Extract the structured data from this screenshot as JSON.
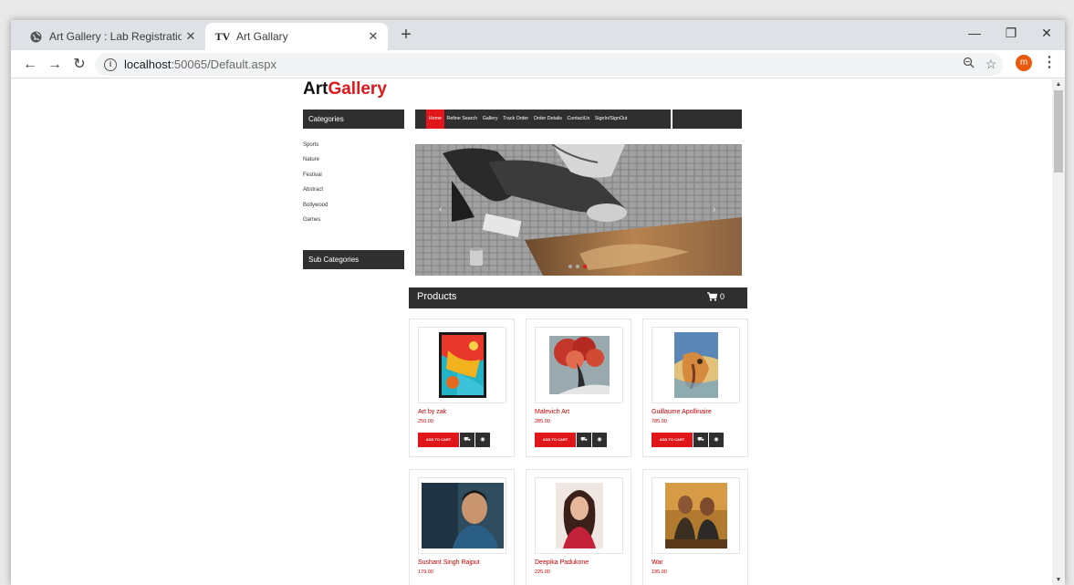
{
  "browser": {
    "tabs": [
      {
        "title": "Art Gallery : Lab Registration",
        "favicon": "globe-icon",
        "active": false
      },
      {
        "title": "Art Gallary",
        "favicon": "TV",
        "active": true
      }
    ],
    "url_host": "localhost",
    "url_rest": ":50065/Default.aspx",
    "avatar_letter": "m"
  },
  "brand": {
    "part1": "Art",
    "part2": "Gallery"
  },
  "sidebar": {
    "categories_title": "Categories",
    "categories": [
      "Sports",
      "Nature",
      "Festival",
      "Abstract",
      "Bollywood",
      "Games"
    ],
    "subcategories_title": "Sub Categories"
  },
  "nav": {
    "items": [
      "Home",
      "Refine Search",
      "Gallery",
      "Track Order",
      "Order Details",
      "ContactUs",
      "SignIn/SignOut"
    ],
    "active": "Home"
  },
  "products": {
    "title": "Products",
    "cart_count": "0",
    "add_to_cart_label": "ADD TO CART",
    "items": [
      {
        "name": "Art by zak",
        "price": "250.00"
      },
      {
        "name": "Malevich Art",
        "price": "285.00"
      },
      {
        "name": "Guillaume Apollinaire",
        "price": "785.00"
      },
      {
        "name": "Sushant Singh Rajput",
        "price": "179.00"
      },
      {
        "name": "Deepika Padukone",
        "price": "225.00"
      },
      {
        "name": "War",
        "price": "195.00"
      }
    ]
  },
  "colors": {
    "accent": "#e0161b",
    "dark": "#2f2f2f"
  }
}
